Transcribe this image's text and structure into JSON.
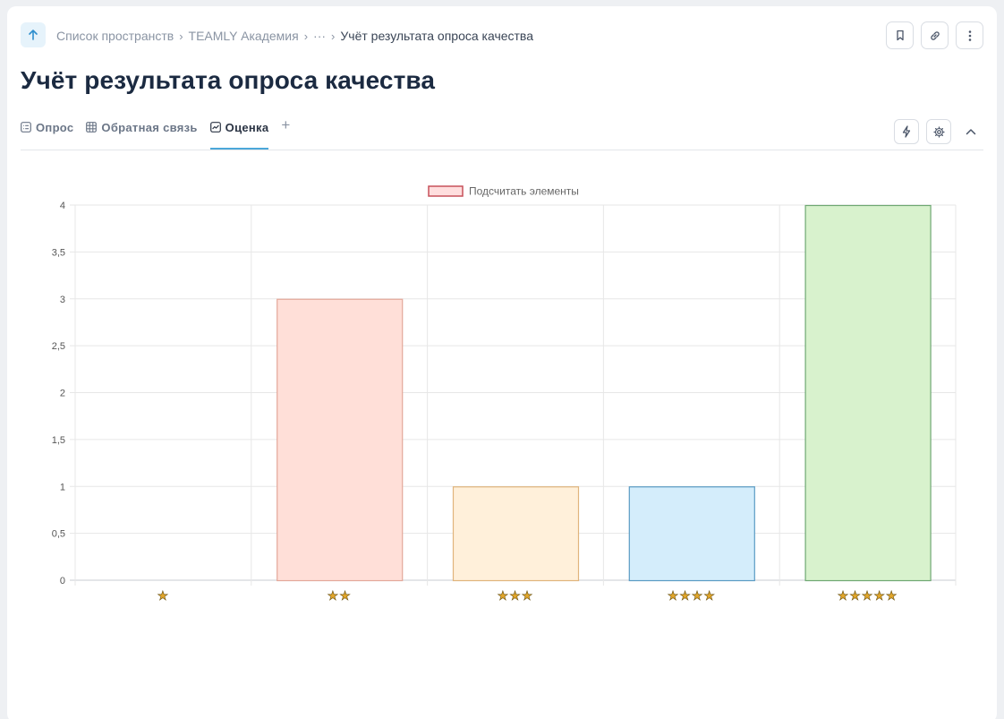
{
  "breadcrumb": {
    "items": [
      "Список пространств",
      "TEAMLY Академия",
      "···",
      "Учёт результата опроса качества"
    ]
  },
  "page": {
    "title": "Учёт результата опроса качества"
  },
  "tabs": [
    {
      "label": "Опрос",
      "icon": "list-icon"
    },
    {
      "label": "Обратная связь",
      "icon": "table-icon"
    },
    {
      "label": "Оценка",
      "icon": "chart-icon",
      "active": true
    }
  ],
  "tab_add": "+",
  "top_actions": [
    "bookmark-icon",
    "link-icon",
    "more-icon"
  ],
  "tab_actions": [
    "lightning-icon",
    "gear-icon",
    "chevron-up-icon"
  ],
  "colors": {
    "accent": "#4ba7d9",
    "title": "#1b2a41"
  },
  "chart_data": {
    "type": "bar",
    "legend": "Подсчитать элементы",
    "legend_position": "top",
    "categories": [
      "★",
      "★★",
      "★★★",
      "★★★★",
      "★★★★★"
    ],
    "values": [
      0,
      3,
      1,
      1,
      4
    ],
    "ylim": [
      0,
      4
    ],
    "yticks": [
      "0",
      "0,5",
      "1",
      "1,5",
      "2",
      "2,5",
      "3",
      "3,5",
      "4"
    ],
    "grid": true,
    "colors": {
      "fill": [
        "#ffe0d9",
        "#ffdfd8",
        "#fff0da",
        "#d4edfb",
        "#d8f2cd"
      ],
      "stroke": [
        "#e3a89a",
        "#e3a89a",
        "#e0b47c",
        "#5a9bc4",
        "#6fa873"
      ]
    },
    "legend_colors": {
      "fill": "#ffdede",
      "stroke": "#c7505a"
    }
  }
}
